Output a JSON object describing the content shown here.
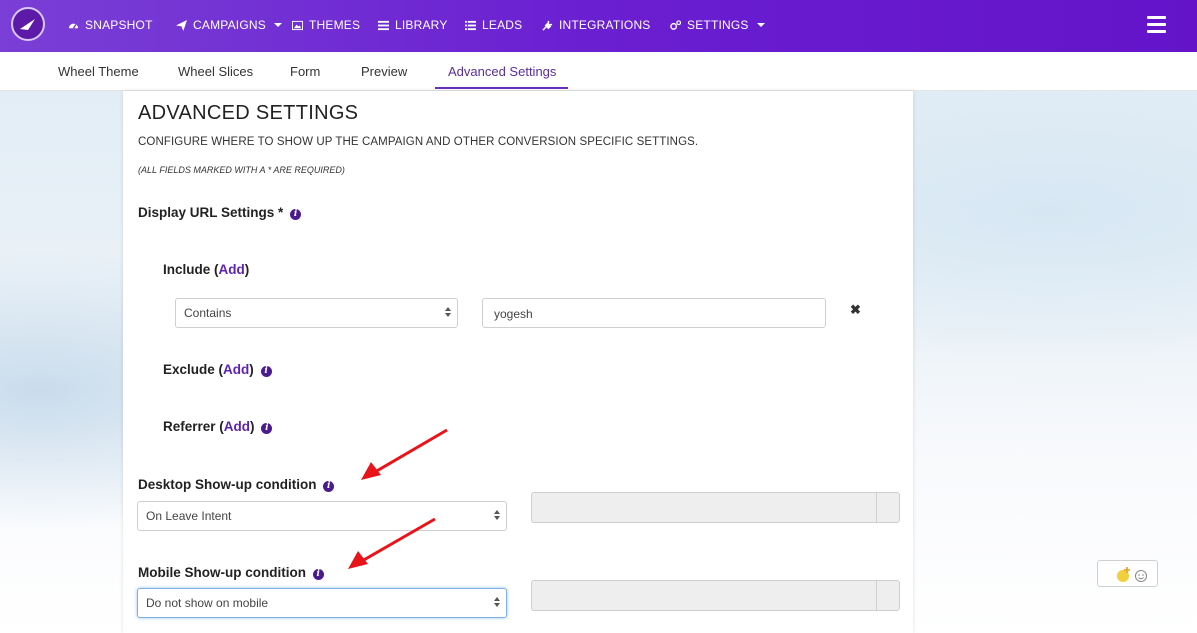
{
  "nav": {
    "items": [
      {
        "label": "SNAPSHOT",
        "icon": "dashboard-icon"
      },
      {
        "label": "CAMPAIGNS",
        "icon": "paper-plane-icon",
        "dropdown": true
      },
      {
        "label": "THEMES",
        "icon": "image-icon"
      },
      {
        "label": "LIBRARY",
        "icon": "library-icon"
      },
      {
        "label": "LEADS",
        "icon": "list-icon"
      },
      {
        "label": "INTEGRATIONS",
        "icon": "plug-icon"
      },
      {
        "label": "SETTINGS",
        "icon": "cogs-icon",
        "dropdown": true
      }
    ]
  },
  "tabs": [
    {
      "label": "Wheel Theme"
    },
    {
      "label": "Wheel Slices"
    },
    {
      "label": "Form"
    },
    {
      "label": "Preview"
    },
    {
      "label": "Advanced Settings",
      "active": true
    }
  ],
  "page": {
    "title": "ADVANCED SETTINGS",
    "subtitle": "CONFIGURE WHERE TO SHOW UP THE CAMPAIGN AND OTHER CONVERSION SPECIFIC SETTINGS.",
    "note": "(ALL FIELDS MARKED WITH A * ARE REQUIRED)"
  },
  "display_url": {
    "label": "Display URL Settings *",
    "include_label": "Include",
    "exclude_label": "Exclude",
    "referrer_label": "Referrer",
    "add_link": "Add",
    "rule": {
      "operator": "Contains",
      "value": "yogesh"
    }
  },
  "desktop": {
    "label": "Desktop Show-up condition",
    "selected": "On Leave Intent"
  },
  "mobile": {
    "label": "Mobile Show-up condition",
    "selected": "Do not show on mobile"
  },
  "colors": {
    "nav_bg": "#6a1fd1",
    "accent": "#5e22b0",
    "annotation_arrow": "#e8141a"
  }
}
